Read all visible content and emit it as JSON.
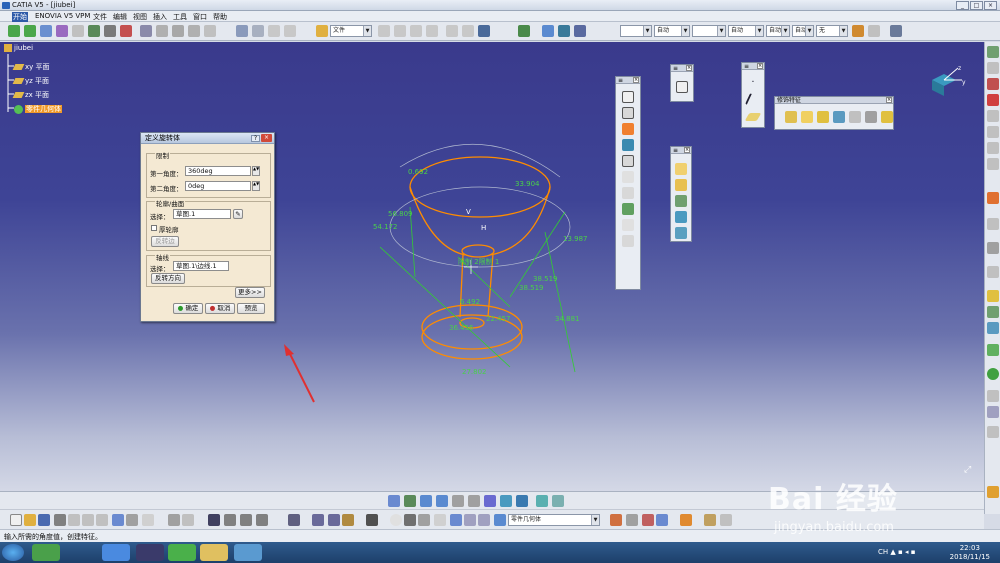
{
  "window": {
    "title": "CATIA V5 - [jiubei]"
  },
  "menu": [
    "开始",
    "ENOVIA V5 VPM",
    "文件",
    "编辑",
    "视图",
    "插入",
    "工具",
    "窗口",
    "帮助"
  ],
  "toolbar": {
    "file_combo": "文件",
    "line_combo": "自动",
    "weight_combo": "自动",
    "layer_combo": "自动",
    "layer_combo2": "自动",
    "filter_combo": "无"
  },
  "tree": {
    "root": "jiubei",
    "items": [
      "xy 平面",
      "yz 平面",
      "zx 平面",
      "零件几何体"
    ]
  },
  "palettes": {
    "modify": {
      "title": "修饰特征"
    }
  },
  "dialog": {
    "title": "定义旋转体",
    "limits_group": "限制",
    "first_angle_label": "第一角度：",
    "first_angle_value": "360deg",
    "second_angle_label": "第二角度：",
    "second_angle_value": "0deg",
    "profile_group": "轮廓/曲面",
    "select_label": "选择：",
    "profile_value": "草图.1",
    "thick_profile": "厚轮廓",
    "reverse_side": "反转边",
    "axis_group": "轴线",
    "axis_select_label": "选择：",
    "axis_value": "草图.1\\边线.1",
    "reverse_dir": "反转方向",
    "more": "更多>>",
    "ok": "确定",
    "cancel": "取消",
    "preview": "预览"
  },
  "dims": {
    "d1": "0.692",
    "d2": "56.809",
    "d3": "33.904",
    "d4": "54.172",
    "d5": "13.987",
    "d6": "限制 2限制 1",
    "d7": "38.519",
    "d8": "38.519",
    "d9": "6.492",
    "d10": "22.457",
    "d11": "34.881",
    "d12": "36.456",
    "d13": "27.802",
    "axis_h": "H",
    "axis_v": "V"
  },
  "bottom": {
    "part_combo": "零件几何体"
  },
  "status": {
    "text": "输入所需的角度值，创建特征。"
  },
  "clock": {
    "time": "22:03",
    "date": "2018/11/15"
  },
  "watermark": {
    "brand": "Bai 经验",
    "url": "jingyan.baidu.com"
  },
  "colors": {
    "canvas_top": "#3a3a8c",
    "highlight": "#f09a2a",
    "dim_green": "#33cc33",
    "profile_orange": "#ff8c00"
  }
}
